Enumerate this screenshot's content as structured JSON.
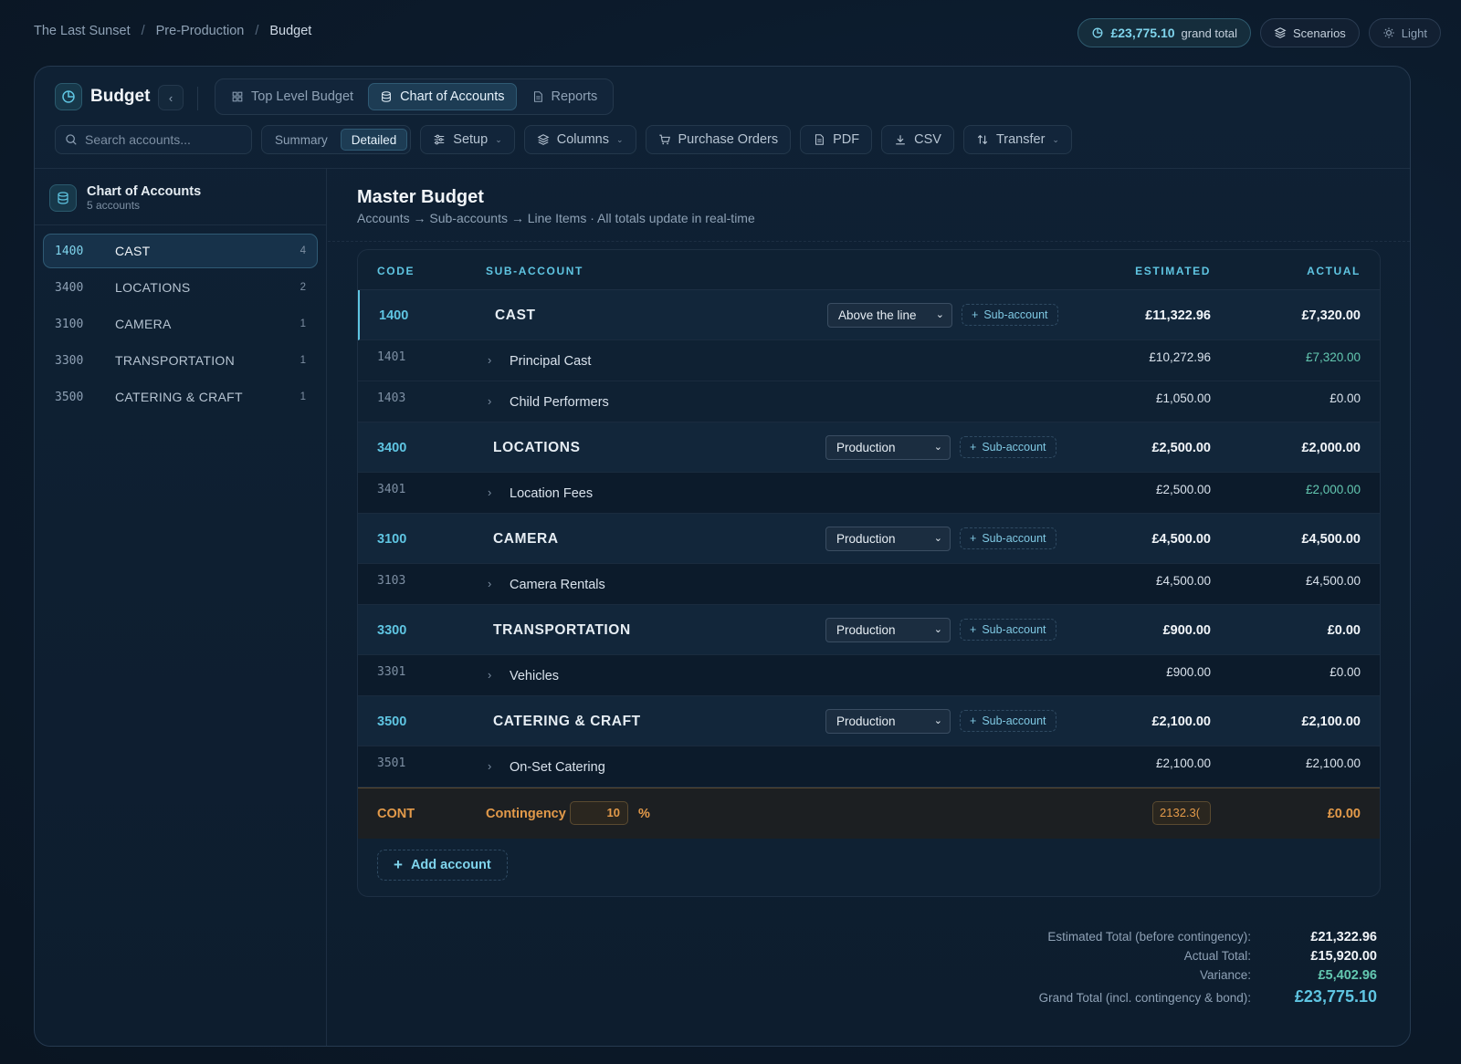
{
  "breadcrumb": [
    "The Last Sunset",
    "Pre-Production",
    "Budget"
  ],
  "top": {
    "grand_total_amount": "£23,775.10",
    "grand_total_label": "grand total",
    "scenarios_label": "Scenarios",
    "theme_label": "Light"
  },
  "header": {
    "title": "Budget",
    "tabs": [
      {
        "label": "Top Level Budget",
        "active": false
      },
      {
        "label": "Chart of Accounts",
        "active": true
      },
      {
        "label": "Reports",
        "active": false
      }
    ]
  },
  "toolbar": {
    "search_placeholder": "Search accounts...",
    "view_modes": [
      "Summary",
      "Detailed"
    ],
    "active_view": "Detailed",
    "setup_label": "Setup",
    "columns_label": "Columns",
    "purchase_orders_label": "Purchase Orders",
    "pdf_label": "PDF",
    "csv_label": "CSV",
    "transfer_label": "Transfer"
  },
  "sidebar": {
    "title": "Chart of Accounts",
    "subtitle": "5 accounts",
    "items": [
      {
        "code": "1400",
        "name": "CAST",
        "count": "4",
        "active": true
      },
      {
        "code": "3400",
        "name": "LOCATIONS",
        "count": "2",
        "active": false
      },
      {
        "code": "3100",
        "name": "CAMERA",
        "count": "1",
        "active": false
      },
      {
        "code": "3300",
        "name": "TRANSPORTATION",
        "count": "1",
        "active": false
      },
      {
        "code": "3500",
        "name": "CATERING & CRAFT",
        "count": "1",
        "active": false
      }
    ]
  },
  "main": {
    "title": "Master Budget",
    "subtitle": "Accounts → Sub-accounts → Line Items · All totals update in real-time",
    "columns": {
      "code": "CODE",
      "sub_account": "SUB-ACCOUNT",
      "estimated": "ESTIMATED",
      "actual": "ACTUAL"
    },
    "sub_account_button": "Sub-account",
    "accounts": [
      {
        "code": "1400",
        "name": "CAST",
        "category": "Above the line",
        "estimated": "£11,322.96",
        "actual": "£7,320.00",
        "subs": [
          {
            "code": "1401",
            "name": "Principal Cast",
            "estimated": "£10,272.96",
            "actual": "£7,320.00",
            "actual_highlight": true
          },
          {
            "code": "1403",
            "name": "Child Performers",
            "estimated": "£1,050.00",
            "actual": "£0.00",
            "actual_highlight": false
          }
        ]
      },
      {
        "code": "3400",
        "name": "LOCATIONS",
        "category": "Production",
        "estimated": "£2,500.00",
        "actual": "£2,000.00",
        "subs": [
          {
            "code": "3401",
            "name": "Location Fees",
            "estimated": "£2,500.00",
            "actual": "£2,000.00",
            "actual_highlight": true
          }
        ]
      },
      {
        "code": "3100",
        "name": "CAMERA",
        "category": "Production",
        "estimated": "£4,500.00",
        "actual": "£4,500.00",
        "subs": [
          {
            "code": "3103",
            "name": "Camera Rentals",
            "estimated": "£4,500.00",
            "actual": "£4,500.00",
            "actual_highlight": false
          }
        ]
      },
      {
        "code": "3300",
        "name": "TRANSPORTATION",
        "category": "Production",
        "estimated": "£900.00",
        "actual": "£0.00",
        "subs": [
          {
            "code": "3301",
            "name": "Vehicles",
            "estimated": "£900.00",
            "actual": "£0.00",
            "actual_highlight": false
          }
        ]
      },
      {
        "code": "3500",
        "name": "CATERING & CRAFT",
        "category": "Production",
        "estimated": "£2,100.00",
        "actual": "£2,100.00",
        "subs": [
          {
            "code": "3501",
            "name": "On-Set Catering",
            "estimated": "£2,100.00",
            "actual": "£2,100.00",
            "actual_highlight": false
          }
        ]
      }
    ],
    "contingency": {
      "code": "CONT",
      "label": "Contingency",
      "percent": "10",
      "percent_sign": "%",
      "estimated": "2132.3(",
      "actual": "£0.00"
    },
    "add_account_label": "Add account"
  },
  "totals": [
    {
      "label": "Estimated Total (before contingency):",
      "value": "£21,322.96",
      "style": "normal"
    },
    {
      "label": "Actual Total:",
      "value": "£15,920.00",
      "style": "normal"
    },
    {
      "label": "Variance:",
      "value": "£5,402.96",
      "style": "green"
    },
    {
      "label": "Grand Total (incl. contingency & bond):",
      "value": "£23,775.10",
      "style": "grand"
    }
  ],
  "colors": {
    "accent": "#5fc5e2",
    "contingency": "#e39a4a",
    "positive": "#63c7b0",
    "background": "#0c1b2c"
  }
}
